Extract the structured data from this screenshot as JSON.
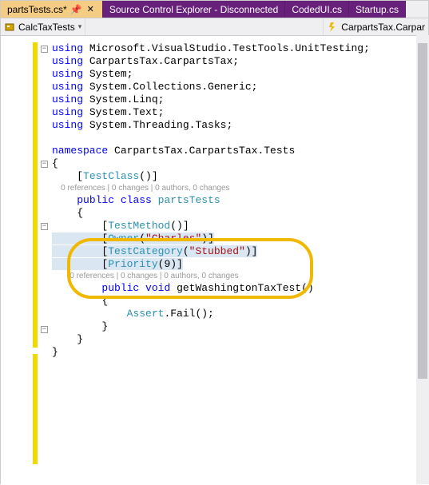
{
  "tabs": {
    "active": "partsTests.cs*",
    "t1_close": "✕",
    "t2": "Source Control Explorer - Disconnected",
    "t3": "CodedUI.cs",
    "t4": "Startup.cs"
  },
  "nav": {
    "left": "CalcTaxTests",
    "right": "CarpartsTax.Carpar"
  },
  "code": {
    "l1a": "using",
    "l1b": " Microsoft.VisualStudio.TestTools.UnitTesting;",
    "l2a": "using",
    "l2b": " CarpartsTax.CarpartsTax;",
    "l3a": "using",
    "l3b": " System;",
    "l4a": "using",
    "l4b": " System.Collections.Generic;",
    "l5a": "using",
    "l5b": " System.Linq;",
    "l6a": "using",
    "l6b": " System.Text;",
    "l7a": "using",
    "l7b": " System.Threading.Tasks;",
    "l9a": "namespace",
    "l9b": " CarpartsTax.CarpartsTax.Tests",
    "l10": "{",
    "l11a": "    [",
    "l11b": "TestClass",
    "l11c": "()]",
    "cl1": "    0 references | 0 changes | 0 authors, 0 changes",
    "l13a": "    ",
    "l13b": "public",
    "l13c": " ",
    "l13d": "class",
    "l13e": " ",
    "l13f": "partsTests",
    "l14": "    {",
    "l15a": "        [",
    "l15b": "TestMethod",
    "l15c": "()]",
    "l16a": "        [",
    "l16b": "Owner",
    "l16c": "(",
    "l16d": "\"Charles\"",
    "l16e": ")]",
    "l17a": "        [",
    "l17b": "TestCategory",
    "l17c": "(",
    "l17d": "\"Stubbed\"",
    "l17e": ")]",
    "l18a": "        [",
    "l18b": "Priority",
    "l18c": "(9)]",
    "cl2": "        0 references | 0 changes | 0 authors, 0 changes",
    "l20a": "        ",
    "l20b": "public",
    "l20c": " ",
    "l20d": "void",
    "l20e": " getWashingtonTaxTest()",
    "l21": "        {",
    "l22a": "            ",
    "l22b": "Assert",
    "l22c": ".Fail();",
    "l23": "        }",
    "l24": "    }",
    "l25": "}"
  },
  "icons": {
    "class": "class-icon",
    "lightning": "lightning-icon"
  }
}
